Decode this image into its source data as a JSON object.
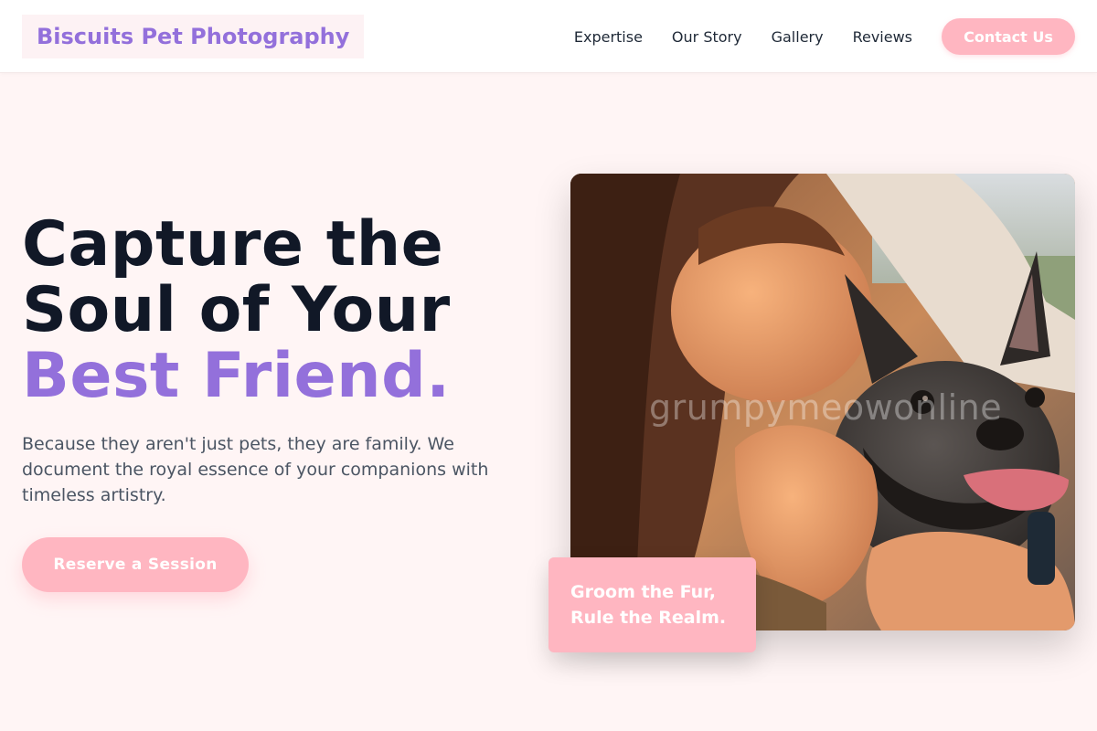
{
  "header": {
    "logo_text": "Biscuits Pet Photography",
    "nav": [
      "Expertise",
      "Our Story",
      "Gallery",
      "Reviews"
    ],
    "cta_label": "Contact Us"
  },
  "hero": {
    "title_line1": "Capture the",
    "title_line2": "Soul of Your",
    "title_line3": "Best Friend.",
    "subtitle": "Because they aren't just pets, they are family. We document the royal essence of your companions with timeless artistry.",
    "cta_label": "Reserve a Session"
  },
  "photo": {
    "watermark": "grumpymeowonline"
  },
  "badge": {
    "line1": "Groom the Fur,",
    "line2": "Rule the Realm."
  },
  "colors": {
    "accent_purple": "#9370db",
    "accent_pink": "#ffb6c1",
    "page_background": "#fff5f5",
    "heading": "#111827"
  }
}
